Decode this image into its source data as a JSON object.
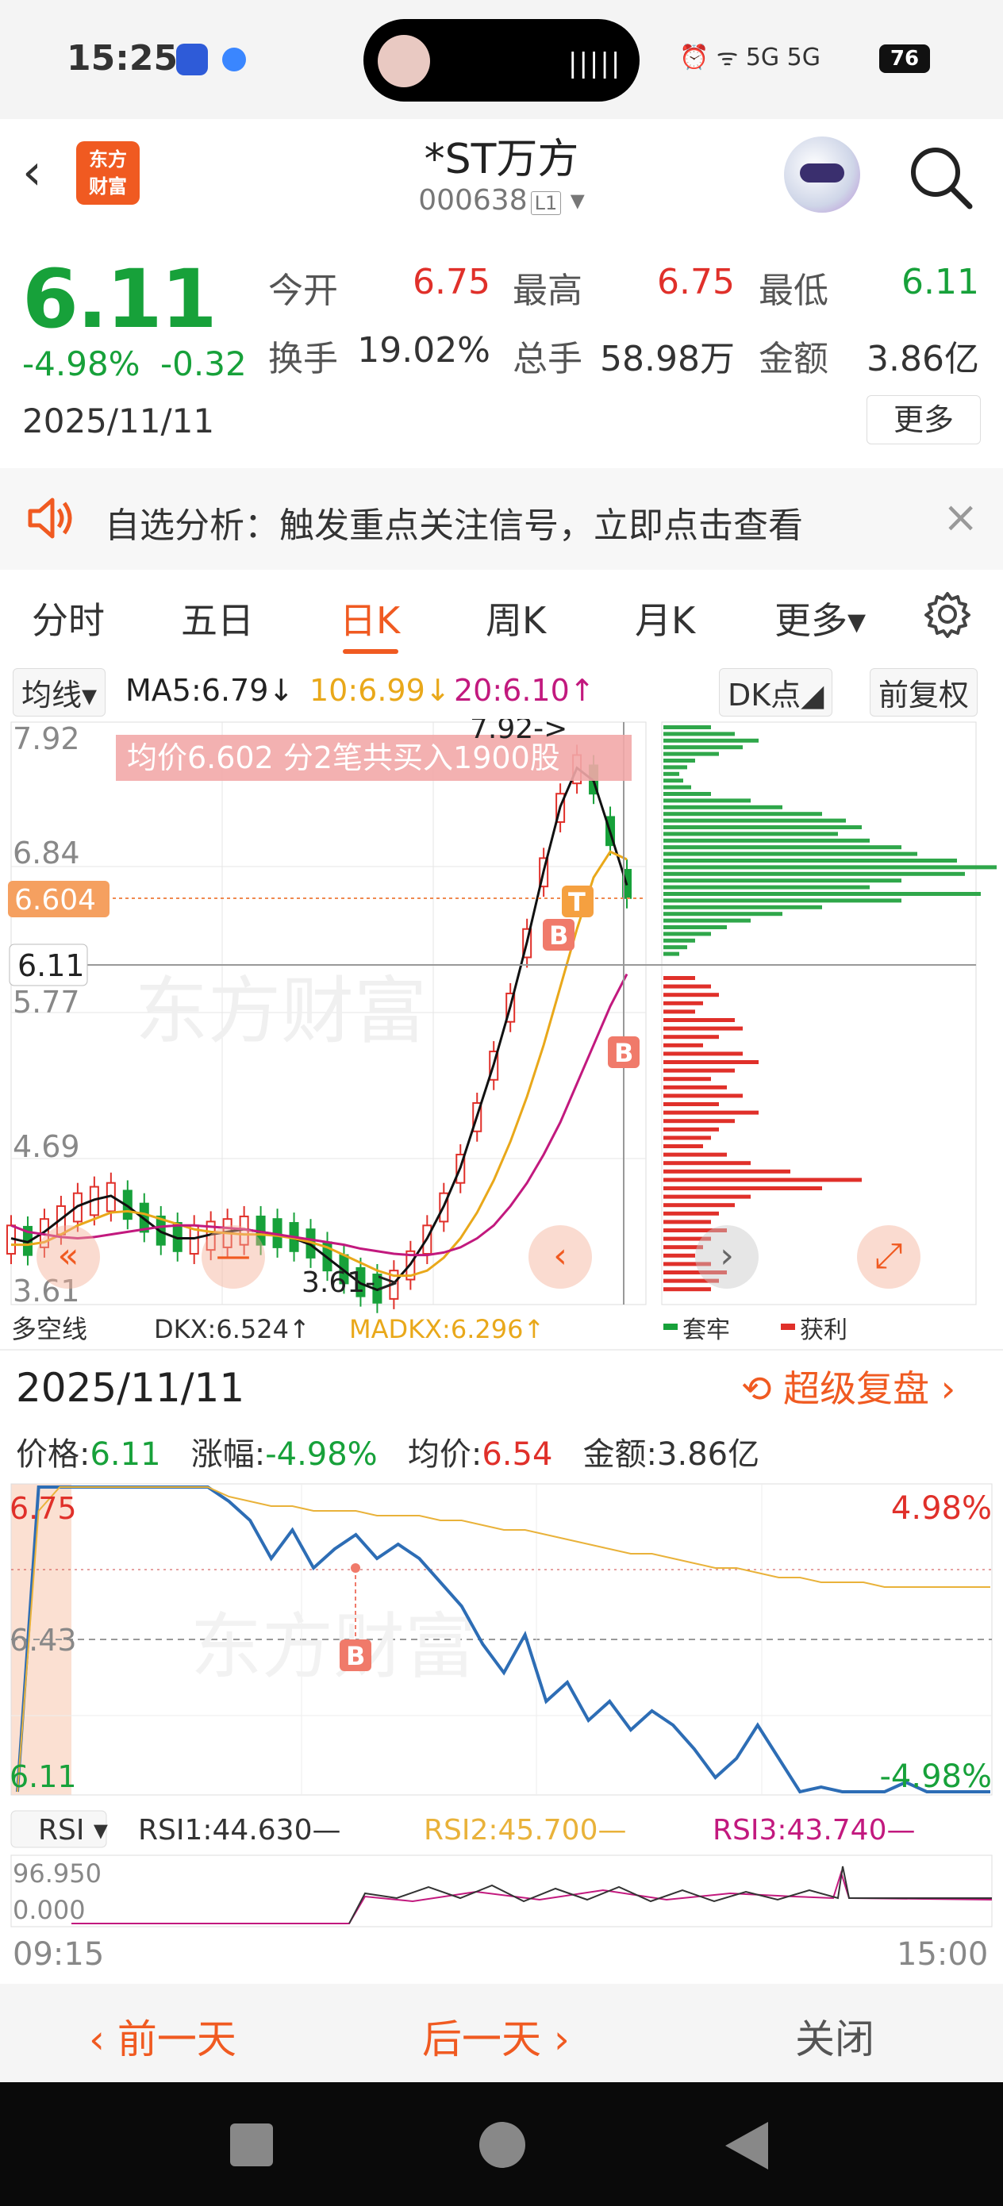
{
  "status_bar": {
    "time": "15:25",
    "island_wave": "|||||",
    "right_icons": "⏰ ᯤ 5G 5G",
    "battery": "76"
  },
  "header": {
    "back_icon": "‹",
    "logo_text": "东方财富",
    "logo_line1": "东方",
    "logo_line2": "财富",
    "name": "*ST万方",
    "code": "000638",
    "code_badge": "L1",
    "code_arrow": "▾"
  },
  "quote": {
    "price": "6.11",
    "change_pct": "-4.98%",
    "change_amt": "-0.32",
    "date": "2025/11/11",
    "open_label": "今开",
    "open": "6.75",
    "high_label": "最高",
    "high": "6.75",
    "low_label": "最低",
    "low": "6.11",
    "turnover_label": "换手",
    "turnover": "19.02%",
    "volume_label": "总手",
    "volume": "58.98万",
    "amount_label": "金额",
    "amount": "3.86亿",
    "more": "更多"
  },
  "notice": {
    "text": "自选分析：触发重点关注信号，立即点击查看",
    "close": "×"
  },
  "tabs": [
    {
      "label": "分时"
    },
    {
      "label": "五日"
    },
    {
      "label": "日K"
    },
    {
      "label": "周K"
    },
    {
      "label": "月K"
    },
    {
      "label": "更多▾"
    }
  ],
  "active_tab": "日K",
  "indicators": {
    "selector": "均线▾",
    "ma5": "MA5:6.79↓",
    "ma10": "10:6.99↓",
    "ma20": "20:6.10↑",
    "dk": "DK点◢",
    "adjust": "前复权"
  },
  "kline": {
    "watermark": "东方财富",
    "y_labels": [
      "7.92",
      "6.84",
      "5.77",
      "4.69",
      "3.61"
    ],
    "current_price_tag": "6.604",
    "last_price_tag": "6.11",
    "high_marker": "7.92->",
    "low_marker": "3.61->",
    "banner": "均价6.602  分2笔共买入1900股",
    "marker_b": "B",
    "marker_t": "T",
    "bottom_legend": [
      "多空线",
      "DKX:6.524↑",
      "MADKX:6.296↑",
      "套牢",
      "获利"
    ],
    "nav_prev_icon": "«",
    "nav_minus_icon": "—",
    "nav_left_icon": "‹",
    "nav_right_icon": "›",
    "nav_expand_icon": "⤢"
  },
  "chart_data": [
    {
      "type": "candlestick",
      "title": "日K",
      "ylim": [
        3.61,
        7.92
      ],
      "series": [
        {
          "name": "MA5",
          "color": "#111111",
          "values": [
            4.05,
            4.02,
            4.1,
            4.2,
            4.3,
            4.35,
            4.38,
            4.3,
            4.2,
            4.1,
            4.05,
            4.05,
            4.08,
            4.1,
            4.12,
            4.1,
            4.08,
            4.05,
            4.0,
            3.9,
            3.8,
            3.7,
            3.65,
            3.7,
            3.85,
            4.05,
            4.3,
            4.6,
            5.0,
            5.4,
            5.85,
            6.35,
            6.9,
            7.4,
            7.7,
            7.6,
            7.2,
            6.79
          ]
        },
        {
          "name": "MA10",
          "color": "#e9a81a",
          "values": [
            4.0,
            4.0,
            4.02,
            4.08,
            4.15,
            4.2,
            4.25,
            4.26,
            4.24,
            4.2,
            4.16,
            4.12,
            4.1,
            4.09,
            4.08,
            4.08,
            4.07,
            4.05,
            4.02,
            3.98,
            3.92,
            3.86,
            3.8,
            3.76,
            3.76,
            3.8,
            3.9,
            4.05,
            4.25,
            4.5,
            4.8,
            5.15,
            5.55,
            6.0,
            6.45,
            6.85,
            7.05,
            6.99
          ]
        },
        {
          "name": "MA20",
          "color": "#c2197e",
          "values": [
            4.15,
            4.1,
            4.08,
            4.06,
            4.05,
            4.06,
            4.08,
            4.1,
            4.12,
            4.14,
            4.15,
            4.15,
            4.14,
            4.13,
            4.12,
            4.1,
            4.08,
            4.06,
            4.04,
            4.02,
            4.0,
            3.97,
            3.95,
            3.93,
            3.92,
            3.92,
            3.94,
            3.98,
            4.05,
            4.15,
            4.3,
            4.48,
            4.7,
            4.95,
            5.25,
            5.55,
            5.85,
            6.1
          ]
        }
      ],
      "avg_cost": 6.604,
      "last": 6.11
    },
    {
      "type": "line",
      "title": "分时",
      "x_range": [
        "09:15",
        "15:00"
      ],
      "ylim": [
        6.11,
        6.75
      ],
      "y_labels": [
        "6.75",
        "6.43",
        "6.11"
      ],
      "right_labels": [
        "4.98%",
        "-4.98%"
      ],
      "series": [
        {
          "name": "价格",
          "color": "#2d6db5",
          "values": [
            6.11,
            6.75,
            6.75,
            6.75,
            6.75,
            6.75,
            6.75,
            6.75,
            6.75,
            6.75,
            6.72,
            6.68,
            6.6,
            6.66,
            6.58,
            6.62,
            6.65,
            6.6,
            6.63,
            6.6,
            6.55,
            6.5,
            6.42,
            6.36,
            6.44,
            6.3,
            6.34,
            6.26,
            6.3,
            6.24,
            6.28,
            6.25,
            6.2,
            6.14,
            6.18,
            6.25,
            6.18,
            6.11,
            6.12,
            6.11,
            6.11,
            6.11,
            6.13,
            6.11,
            6.11,
            6.11,
            6.11
          ]
        },
        {
          "name": "均价",
          "color": "#e9b23a",
          "values": [
            6.11,
            6.7,
            6.75,
            6.75,
            6.75,
            6.75,
            6.75,
            6.75,
            6.75,
            6.75,
            6.73,
            6.72,
            6.71,
            6.71,
            6.7,
            6.7,
            6.7,
            6.69,
            6.69,
            6.69,
            6.68,
            6.68,
            6.67,
            6.66,
            6.66,
            6.65,
            6.64,
            6.63,
            6.62,
            6.61,
            6.61,
            6.6,
            6.59,
            6.58,
            6.58,
            6.57,
            6.56,
            6.56,
            6.55,
            6.55,
            6.55,
            6.54,
            6.54,
            6.54,
            6.54,
            6.54,
            6.54
          ]
        }
      ]
    }
  ],
  "review": {
    "date": "2025/11/11",
    "super_review": "超级复盘 ›",
    "price_label": "价格:",
    "price": "6.11",
    "change_label": "涨幅:",
    "change": "-4.98%",
    "avg_label": "均价:",
    "avg": "6.54",
    "amount_label": "金额:",
    "amount": "3.86亿",
    "rsi_selector": "RSI ▾",
    "rsi1": "RSI1:44.630—",
    "rsi2": "RSI2:45.700—",
    "rsi3": "RSI3:43.740—",
    "rsi_top": "96.950",
    "rsi_bottom": "0.000",
    "time_start": "09:15",
    "time_end": "15:00"
  },
  "footer": {
    "prev": "‹ 前一天",
    "next": "后一天 ›",
    "close": "关闭"
  },
  "colors": {
    "up": "#e0302a",
    "down": "#17a13a",
    "accent": "#f05a21"
  }
}
